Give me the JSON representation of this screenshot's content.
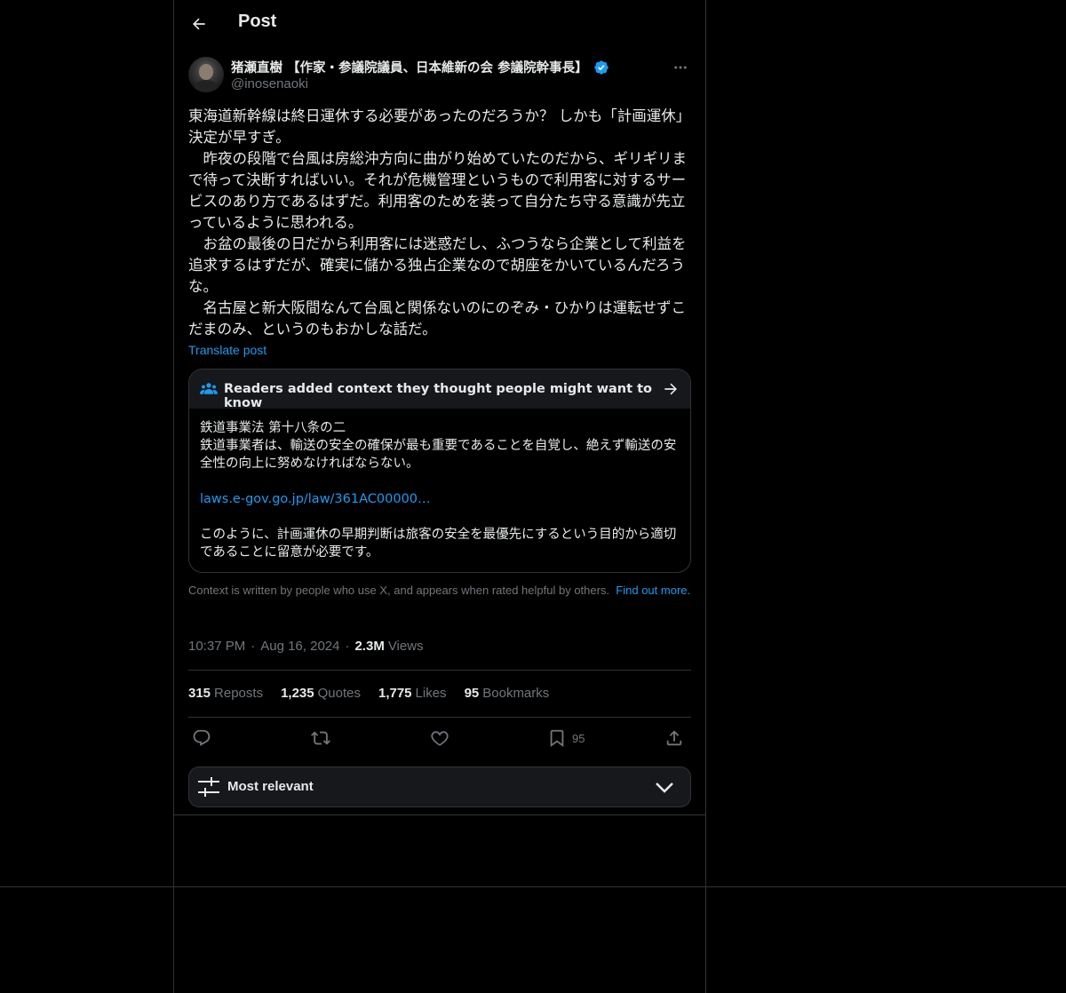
{
  "header": {
    "title": "Post"
  },
  "author": {
    "display_name": "猪瀬直樹 【作家・参議院議員、日本維新の会 参議院幹事長】",
    "handle": "@inosenaoki",
    "verified": true
  },
  "post": {
    "text": "東海道新幹線は終日運休する必要があったのだろうか？ しかも「計画運休」決定が早すぎ。\n　昨夜の段階で台風は房総沖方向に曲がり始めていたのだから、ギリギリまで待って決断すればいい。それが危機管理というもので利用客に対するサービスのあり方であるはずだ。利用客のためを装って自分たち守る意識が先立っているように思われる。\n　お盆の最後の日だから利用客には迷惑だし、ふつうなら企業として利益を追求するはずだが、確実に儲かる独占企業なので胡座をかいているんだろうな。\n　名古屋と新大阪間なんて台風と関係ないのにのぞみ・ひかりは運転せずこだまのみ、というのもおかしな話だ。",
    "translate_label": "Translate post"
  },
  "community_note": {
    "title": "Readers added context they thought people might want to know",
    "line1": "鉄道事業法 第十八条の二",
    "line2": "鉄道事業者は、輸送の安全の確保が最も重要であることを自覚し、絶えず輸送の安全性の向上に努めなければならない。",
    "link": "laws.e-gov.go.jp/law/361AC00000…",
    "line3": "このように、計画運休の早期判断は旅客の安全を最優先にするという目的から適切であることに留意が必要です。"
  },
  "context_footer": {
    "text": "Context is written by people who use X, and appears when rated helpful by others.",
    "link": "Find out more."
  },
  "meta": {
    "time": "10:37 PM",
    "date": "Aug 16, 2024",
    "views_count": "2.3M",
    "views_label": "Views"
  },
  "stats": [
    {
      "num": "315",
      "label": "Reposts"
    },
    {
      "num": "1,235",
      "label": "Quotes"
    },
    {
      "num": "1,775",
      "label": "Likes"
    },
    {
      "num": "95",
      "label": "Bookmarks"
    }
  ],
  "actions": {
    "icons": [
      "reply-icon",
      "repost-icon",
      "like-icon",
      "bookmark-icon",
      "share-icon"
    ],
    "bookmark_count": "95"
  },
  "sort": {
    "label": "Most relevant"
  },
  "colors": {
    "background": "#000000",
    "text": "#e7e9ea",
    "secondary": "#71767b",
    "accent": "#1d9bf0",
    "border": "#2f3336",
    "note_header": "#16181c"
  }
}
